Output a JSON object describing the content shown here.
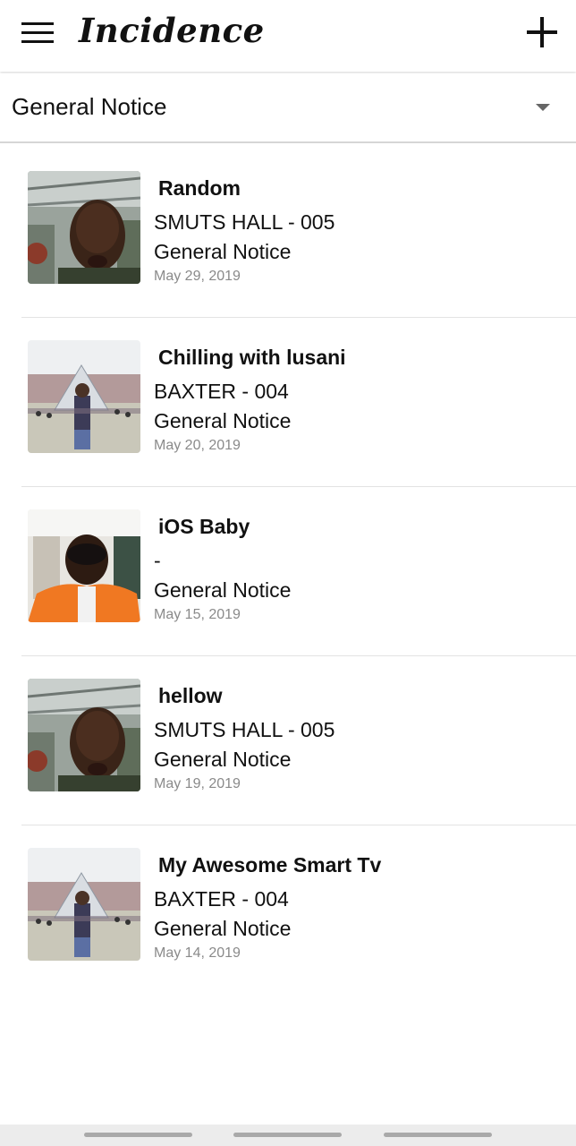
{
  "header": {
    "title": "Incidence",
    "menu_icon": "hamburger-menu-icon",
    "add_icon": "plus-icon"
  },
  "filter": {
    "selected": "General Notice",
    "arrow_icon": "dropdown-arrow-icon"
  },
  "incidents": [
    {
      "title": "Random",
      "location": "SMUTS HALL - 005",
      "category": "General Notice",
      "date": "May 29, 2019",
      "thumbnail": "selfie-indoor"
    },
    {
      "title": "Chilling with lusani",
      "location": "BAXTER - 004",
      "category": "General Notice",
      "date": "May 20, 2019",
      "thumbnail": "louvre-pyramid"
    },
    {
      "title": "iOS Baby",
      "location": " -",
      "category": "General Notice",
      "date": "May 15, 2019",
      "thumbnail": "selfie-orange-jacket"
    },
    {
      "title": "hellow",
      "location": "SMUTS HALL - 005",
      "category": "General Notice",
      "date": "May 19, 2019",
      "thumbnail": "selfie-indoor"
    },
    {
      "title": "My Awesome Smart Tv",
      "location": "BAXTER - 004",
      "category": "General Notice",
      "date": "May 14, 2019",
      "thumbnail": "louvre-pyramid"
    }
  ],
  "colors": {
    "background": "#ffffff",
    "text": "#111111",
    "date_text": "#8a8a8a",
    "divider": "#e3e3e3"
  }
}
